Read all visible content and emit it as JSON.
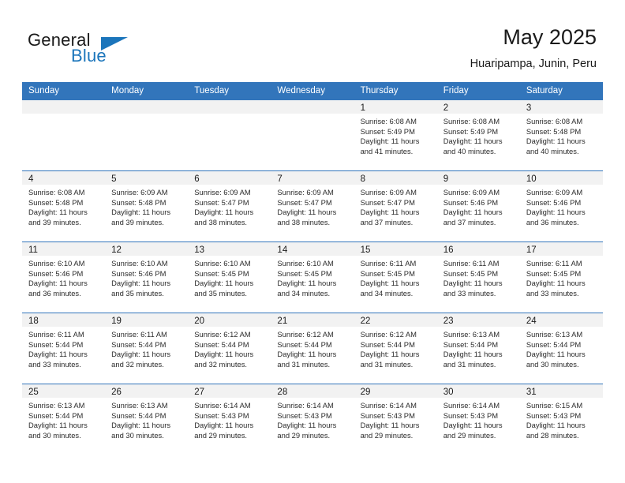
{
  "brand": {
    "name_part1": "General",
    "name_part2": "Blue",
    "flag_icon": "triangle-flag-icon",
    "accent_color": "#1b75bb"
  },
  "header": {
    "title": "May 2025",
    "subtitle": "Huaripampa, Junin, Peru"
  },
  "calendar": {
    "header_bg_color": "#3275bb",
    "day_band_color": "#f2f2f2",
    "weekdays": [
      "Sunday",
      "Monday",
      "Tuesday",
      "Wednesday",
      "Thursday",
      "Friday",
      "Saturday"
    ],
    "weeks": [
      [
        {
          "day": "",
          "sunrise": "",
          "sunset": "",
          "daylight_line1": "",
          "daylight_line2": ""
        },
        {
          "day": "",
          "sunrise": "",
          "sunset": "",
          "daylight_line1": "",
          "daylight_line2": ""
        },
        {
          "day": "",
          "sunrise": "",
          "sunset": "",
          "daylight_line1": "",
          "daylight_line2": ""
        },
        {
          "day": "",
          "sunrise": "",
          "sunset": "",
          "daylight_line1": "",
          "daylight_line2": ""
        },
        {
          "day": "1",
          "sunrise": "Sunrise: 6:08 AM",
          "sunset": "Sunset: 5:49 PM",
          "daylight_line1": "Daylight: 11 hours",
          "daylight_line2": "and 41 minutes."
        },
        {
          "day": "2",
          "sunrise": "Sunrise: 6:08 AM",
          "sunset": "Sunset: 5:49 PM",
          "daylight_line1": "Daylight: 11 hours",
          "daylight_line2": "and 40 minutes."
        },
        {
          "day": "3",
          "sunrise": "Sunrise: 6:08 AM",
          "sunset": "Sunset: 5:48 PM",
          "daylight_line1": "Daylight: 11 hours",
          "daylight_line2": "and 40 minutes."
        }
      ],
      [
        {
          "day": "4",
          "sunrise": "Sunrise: 6:08 AM",
          "sunset": "Sunset: 5:48 PM",
          "daylight_line1": "Daylight: 11 hours",
          "daylight_line2": "and 39 minutes."
        },
        {
          "day": "5",
          "sunrise": "Sunrise: 6:09 AM",
          "sunset": "Sunset: 5:48 PM",
          "daylight_line1": "Daylight: 11 hours",
          "daylight_line2": "and 39 minutes."
        },
        {
          "day": "6",
          "sunrise": "Sunrise: 6:09 AM",
          "sunset": "Sunset: 5:47 PM",
          "daylight_line1": "Daylight: 11 hours",
          "daylight_line2": "and 38 minutes."
        },
        {
          "day": "7",
          "sunrise": "Sunrise: 6:09 AM",
          "sunset": "Sunset: 5:47 PM",
          "daylight_line1": "Daylight: 11 hours",
          "daylight_line2": "and 38 minutes."
        },
        {
          "day": "8",
          "sunrise": "Sunrise: 6:09 AM",
          "sunset": "Sunset: 5:47 PM",
          "daylight_line1": "Daylight: 11 hours",
          "daylight_line2": "and 37 minutes."
        },
        {
          "day": "9",
          "sunrise": "Sunrise: 6:09 AM",
          "sunset": "Sunset: 5:46 PM",
          "daylight_line1": "Daylight: 11 hours",
          "daylight_line2": "and 37 minutes."
        },
        {
          "day": "10",
          "sunrise": "Sunrise: 6:09 AM",
          "sunset": "Sunset: 5:46 PM",
          "daylight_line1": "Daylight: 11 hours",
          "daylight_line2": "and 36 minutes."
        }
      ],
      [
        {
          "day": "11",
          "sunrise": "Sunrise: 6:10 AM",
          "sunset": "Sunset: 5:46 PM",
          "daylight_line1": "Daylight: 11 hours",
          "daylight_line2": "and 36 minutes."
        },
        {
          "day": "12",
          "sunrise": "Sunrise: 6:10 AM",
          "sunset": "Sunset: 5:46 PM",
          "daylight_line1": "Daylight: 11 hours",
          "daylight_line2": "and 35 minutes."
        },
        {
          "day": "13",
          "sunrise": "Sunrise: 6:10 AM",
          "sunset": "Sunset: 5:45 PM",
          "daylight_line1": "Daylight: 11 hours",
          "daylight_line2": "and 35 minutes."
        },
        {
          "day": "14",
          "sunrise": "Sunrise: 6:10 AM",
          "sunset": "Sunset: 5:45 PM",
          "daylight_line1": "Daylight: 11 hours",
          "daylight_line2": "and 34 minutes."
        },
        {
          "day": "15",
          "sunrise": "Sunrise: 6:11 AM",
          "sunset": "Sunset: 5:45 PM",
          "daylight_line1": "Daylight: 11 hours",
          "daylight_line2": "and 34 minutes."
        },
        {
          "day": "16",
          "sunrise": "Sunrise: 6:11 AM",
          "sunset": "Sunset: 5:45 PM",
          "daylight_line1": "Daylight: 11 hours",
          "daylight_line2": "and 33 minutes."
        },
        {
          "day": "17",
          "sunrise": "Sunrise: 6:11 AM",
          "sunset": "Sunset: 5:45 PM",
          "daylight_line1": "Daylight: 11 hours",
          "daylight_line2": "and 33 minutes."
        }
      ],
      [
        {
          "day": "18",
          "sunrise": "Sunrise: 6:11 AM",
          "sunset": "Sunset: 5:44 PM",
          "daylight_line1": "Daylight: 11 hours",
          "daylight_line2": "and 33 minutes."
        },
        {
          "day": "19",
          "sunrise": "Sunrise: 6:11 AM",
          "sunset": "Sunset: 5:44 PM",
          "daylight_line1": "Daylight: 11 hours",
          "daylight_line2": "and 32 minutes."
        },
        {
          "day": "20",
          "sunrise": "Sunrise: 6:12 AM",
          "sunset": "Sunset: 5:44 PM",
          "daylight_line1": "Daylight: 11 hours",
          "daylight_line2": "and 32 minutes."
        },
        {
          "day": "21",
          "sunrise": "Sunrise: 6:12 AM",
          "sunset": "Sunset: 5:44 PM",
          "daylight_line1": "Daylight: 11 hours",
          "daylight_line2": "and 31 minutes."
        },
        {
          "day": "22",
          "sunrise": "Sunrise: 6:12 AM",
          "sunset": "Sunset: 5:44 PM",
          "daylight_line1": "Daylight: 11 hours",
          "daylight_line2": "and 31 minutes."
        },
        {
          "day": "23",
          "sunrise": "Sunrise: 6:13 AM",
          "sunset": "Sunset: 5:44 PM",
          "daylight_line1": "Daylight: 11 hours",
          "daylight_line2": "and 31 minutes."
        },
        {
          "day": "24",
          "sunrise": "Sunrise: 6:13 AM",
          "sunset": "Sunset: 5:44 PM",
          "daylight_line1": "Daylight: 11 hours",
          "daylight_line2": "and 30 minutes."
        }
      ],
      [
        {
          "day": "25",
          "sunrise": "Sunrise: 6:13 AM",
          "sunset": "Sunset: 5:44 PM",
          "daylight_line1": "Daylight: 11 hours",
          "daylight_line2": "and 30 minutes."
        },
        {
          "day": "26",
          "sunrise": "Sunrise: 6:13 AM",
          "sunset": "Sunset: 5:44 PM",
          "daylight_line1": "Daylight: 11 hours",
          "daylight_line2": "and 30 minutes."
        },
        {
          "day": "27",
          "sunrise": "Sunrise: 6:14 AM",
          "sunset": "Sunset: 5:43 PM",
          "daylight_line1": "Daylight: 11 hours",
          "daylight_line2": "and 29 minutes."
        },
        {
          "day": "28",
          "sunrise": "Sunrise: 6:14 AM",
          "sunset": "Sunset: 5:43 PM",
          "daylight_line1": "Daylight: 11 hours",
          "daylight_line2": "and 29 minutes."
        },
        {
          "day": "29",
          "sunrise": "Sunrise: 6:14 AM",
          "sunset": "Sunset: 5:43 PM",
          "daylight_line1": "Daylight: 11 hours",
          "daylight_line2": "and 29 minutes."
        },
        {
          "day": "30",
          "sunrise": "Sunrise: 6:14 AM",
          "sunset": "Sunset: 5:43 PM",
          "daylight_line1": "Daylight: 11 hours",
          "daylight_line2": "and 29 minutes."
        },
        {
          "day": "31",
          "sunrise": "Sunrise: 6:15 AM",
          "sunset": "Sunset: 5:43 PM",
          "daylight_line1": "Daylight: 11 hours",
          "daylight_line2": "and 28 minutes."
        }
      ]
    ]
  }
}
